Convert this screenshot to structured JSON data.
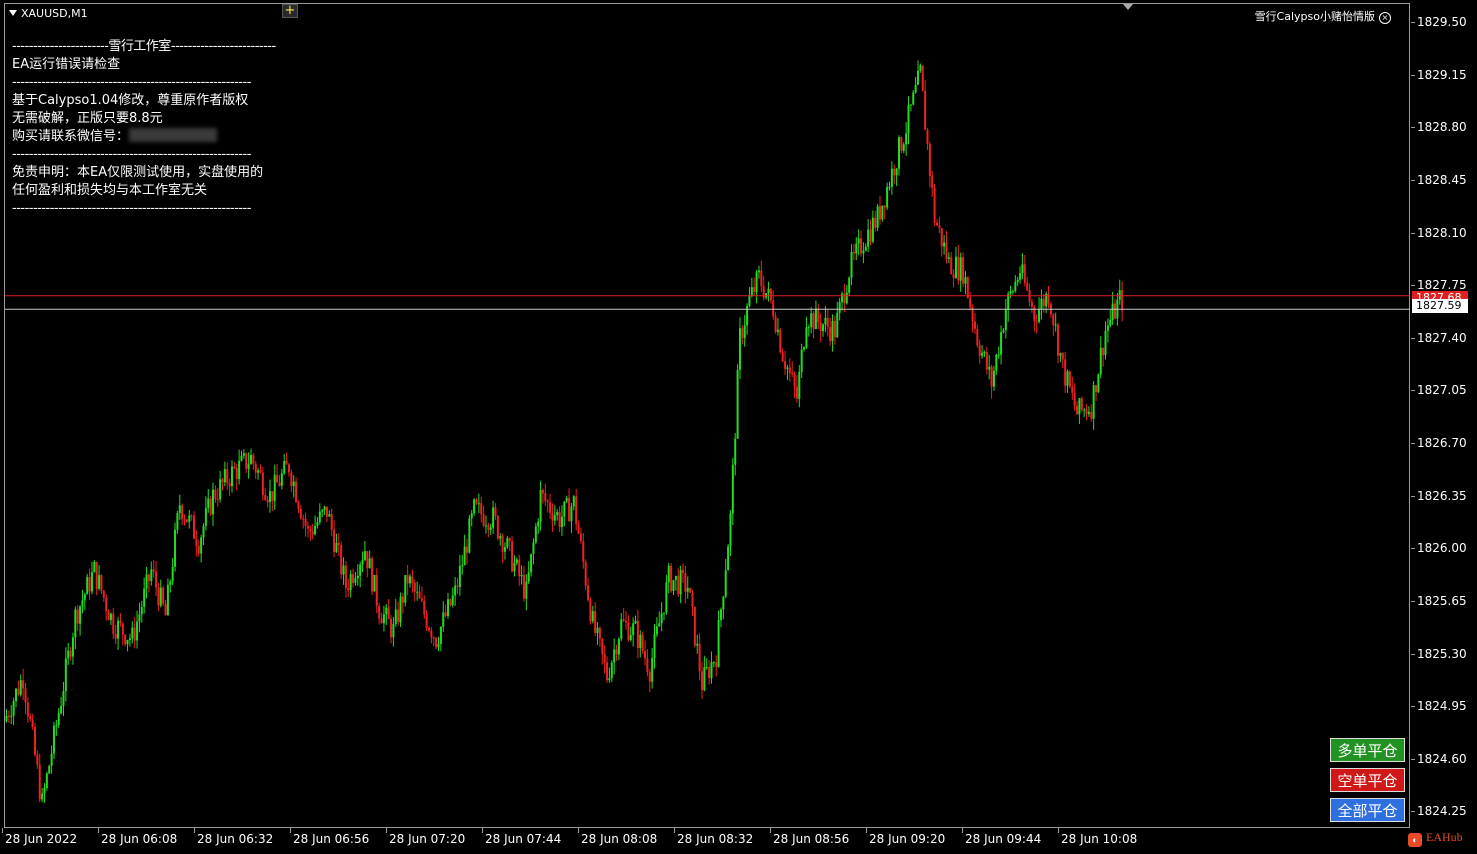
{
  "window": {
    "symbol": "XAUUSD,M1",
    "plus_icon": "+",
    "top_right_label": "雪行Calypso小赌怡情版",
    "top_right_icon": "close-circle-icon"
  },
  "info_panel": {
    "lines": [
      "-----------------------雪行工作室-------------------------",
      "EA运行错误请检查",
      "---------------------------------------------------------",
      "基于Calypso1.04修改，尊重原作者版权",
      "无需破解，正版只要8.8元",
      "购买请联系微信号：",
      "---------------------------------------------------------",
      "免责申明：本EA仅限测试使用，实盘使用的",
      "任何盈利和损失均与本工作室无关",
      "---------------------------------------------------------"
    ]
  },
  "price_axis": {
    "ticks": [
      "1829.50",
      "1829.15",
      "1828.80",
      "1828.45",
      "1828.10",
      "1827.75",
      "1827.40",
      "1827.05",
      "1826.70",
      "1826.35",
      "1826.00",
      "1825.65",
      "1825.30",
      "1824.95",
      "1824.60",
      "1824.25"
    ],
    "bid_price": "1827.68",
    "current_price": "1827.59"
  },
  "time_axis": [
    "28 Jun 2022",
    "28 Jun 06:08",
    "28 Jun 06:32",
    "28 Jun 06:56",
    "28 Jun 07:20",
    "28 Jun 07:44",
    "28 Jun 08:08",
    "28 Jun 08:32",
    "28 Jun 08:56",
    "28 Jun 09:20",
    "28 Jun 09:44",
    "28 Jun 10:08"
  ],
  "buttons": {
    "close_long": "多单平仓",
    "close_short": "空单平仓",
    "close_all": "全部平仓"
  },
  "brand": {
    "logo_icon": "eahub-logo-icon",
    "label": "EAHub"
  },
  "colors": {
    "bull": "#22dd22",
    "bear": "#ee2222",
    "bid_line": "#e02020",
    "price_line": "#c8c8c8"
  },
  "chart_data": {
    "type": "candlestick",
    "ylim": [
      1824.14,
      1829.62
    ],
    "anchors": [
      [
        0,
        1824.85
      ],
      [
        8,
        1825.15
      ],
      [
        16,
        1824.3
      ],
      [
        24,
        1825.0
      ],
      [
        30,
        1825.55
      ],
      [
        38,
        1825.85
      ],
      [
        46,
        1825.5
      ],
      [
        54,
        1825.4
      ],
      [
        62,
        1825.85
      ],
      [
        68,
        1825.55
      ],
      [
        74,
        1826.3
      ],
      [
        82,
        1826.05
      ],
      [
        88,
        1826.35
      ],
      [
        96,
        1826.5
      ],
      [
        104,
        1826.6
      ],
      [
        112,
        1826.35
      ],
      [
        120,
        1826.55
      ],
      [
        128,
        1826.1
      ],
      [
        136,
        1826.25
      ],
      [
        144,
        1825.75
      ],
      [
        152,
        1826.0
      ],
      [
        158,
        1825.6
      ],
      [
        164,
        1825.45
      ],
      [
        170,
        1825.8
      ],
      [
        176,
        1825.6
      ],
      [
        182,
        1825.4
      ],
      [
        190,
        1825.7
      ],
      [
        198,
        1826.25
      ],
      [
        206,
        1826.2
      ],
      [
        212,
        1826.0
      ],
      [
        220,
        1825.7
      ],
      [
        226,
        1826.35
      ],
      [
        234,
        1826.2
      ],
      [
        240,
        1826.3
      ],
      [
        248,
        1825.5
      ],
      [
        254,
        1825.15
      ],
      [
        260,
        1825.5
      ],
      [
        266,
        1825.45
      ],
      [
        272,
        1825.2
      ],
      [
        280,
        1825.8
      ],
      [
        288,
        1825.75
      ],
      [
        294,
        1825.1
      ],
      [
        300,
        1825.3
      ],
      [
        306,
        1826.2
      ],
      [
        310,
        1827.4
      ],
      [
        314,
        1827.65
      ],
      [
        318,
        1827.8
      ],
      [
        324,
        1827.6
      ],
      [
        328,
        1827.3
      ],
      [
        334,
        1827.0
      ],
      [
        338,
        1827.55
      ],
      [
        344,
        1827.5
      ],
      [
        350,
        1827.45
      ],
      [
        356,
        1827.85
      ],
      [
        362,
        1828.05
      ],
      [
        368,
        1828.2
      ],
      [
        374,
        1828.5
      ],
      [
        380,
        1828.8
      ],
      [
        386,
        1829.15
      ],
      [
        392,
        1828.2
      ],
      [
        398,
        1827.9
      ],
      [
        404,
        1827.85
      ],
      [
        410,
        1827.4
      ],
      [
        416,
        1827.1
      ],
      [
        422,
        1827.6
      ],
      [
        428,
        1827.85
      ],
      [
        434,
        1827.55
      ],
      [
        440,
        1827.7
      ],
      [
        446,
        1827.2
      ],
      [
        452,
        1826.9
      ],
      [
        458,
        1826.95
      ],
      [
        464,
        1827.45
      ],
      [
        470,
        1827.65
      ]
    ],
    "candle_count": 471
  }
}
